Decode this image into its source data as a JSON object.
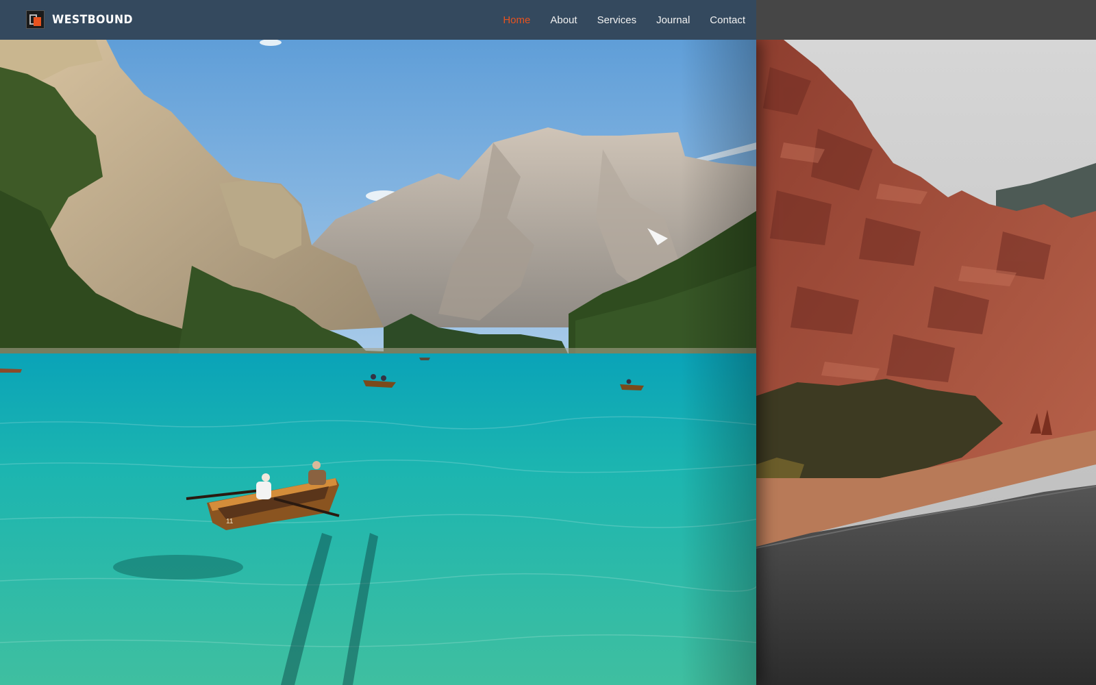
{
  "brand": {
    "name": "WESTBOUND",
    "logo_icon": "westbound-logo-icon"
  },
  "nav": {
    "items": [
      {
        "label": "Home",
        "active": true
      },
      {
        "label": "About",
        "active": false
      },
      {
        "label": "Services",
        "active": false
      },
      {
        "label": "Journal",
        "active": false
      },
      {
        "label": "Contact",
        "active": false
      }
    ],
    "accent_color": "#e8531f"
  },
  "hero": {
    "left_image": {
      "subject": "lake-with-rowboats-and-mountains",
      "boat_number": "11"
    },
    "right_image": {
      "subject": "red-rock-canyon-road"
    }
  },
  "colors": {
    "navbar_left": "#34495e",
    "navbar_right": "#464646",
    "lake": "#1fb3b1",
    "red_rock": "#9e4a3a"
  }
}
